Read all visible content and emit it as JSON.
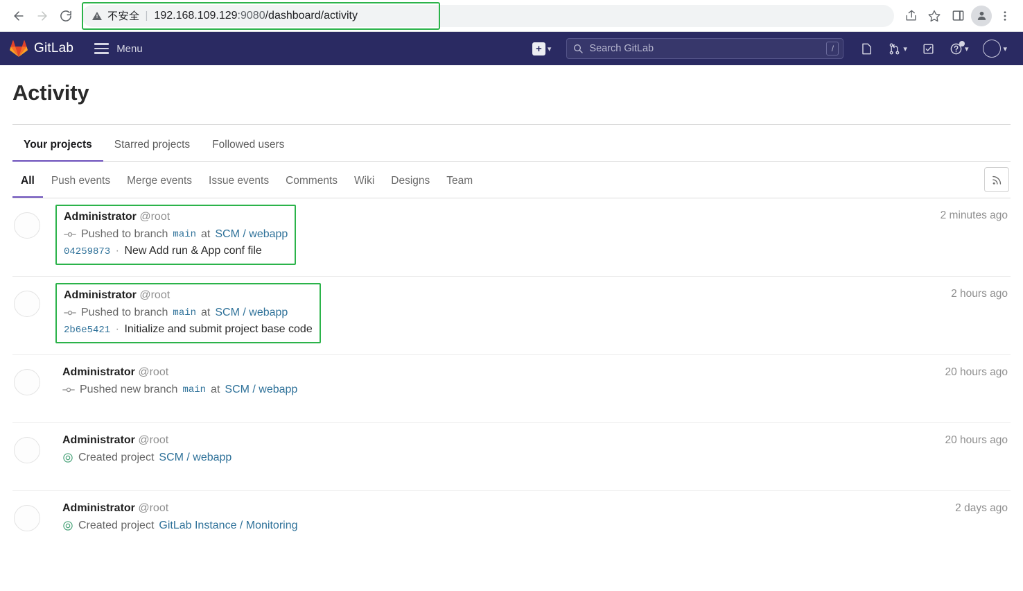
{
  "browser": {
    "back_icon": "back-arrow-icon",
    "forward_icon": "forward-arrow-icon",
    "reload_icon": "reload-icon",
    "security_label": "不安全",
    "url_host": "192.168.109.129",
    "url_port": ":9080",
    "url_path": "/dashboard/activity",
    "separator": "|",
    "share_icon": "share-icon",
    "bookmark_icon": "star-icon",
    "sidepanel_icon": "side-panel-icon",
    "profile_icon": "profile-avatar-icon",
    "menu_icon": "three-dot-menu-icon",
    "annotation_color": "#2bb34a"
  },
  "navbar": {
    "brand": "GitLab",
    "menu_label": "Menu",
    "background": "#2a2a62",
    "create_icon": "plus-square-icon",
    "search": {
      "placeholder": "Search GitLab",
      "shortcut": "/"
    },
    "icons": [
      {
        "name": "issues-icon",
        "label": "Issues"
      },
      {
        "name": "merge-requests-icon",
        "label": "Merge requests"
      },
      {
        "name": "todos-icon",
        "label": "To-Do List"
      },
      {
        "name": "help-icon",
        "label": "Help"
      },
      {
        "name": "user-avatar-icon",
        "label": "User menu"
      }
    ]
  },
  "page": {
    "title": "Activity",
    "top_tabs": [
      {
        "label": "Your projects",
        "active": true
      },
      {
        "label": "Starred projects",
        "active": false
      },
      {
        "label": "Followed users",
        "active": false
      }
    ],
    "filter_tabs": [
      {
        "label": "All",
        "active": true
      },
      {
        "label": "Push events",
        "active": false
      },
      {
        "label": "Merge events",
        "active": false
      },
      {
        "label": "Issue events",
        "active": false
      },
      {
        "label": "Comments",
        "active": false
      },
      {
        "label": "Wiki",
        "active": false
      },
      {
        "label": "Designs",
        "active": false
      },
      {
        "label": "Team",
        "active": false
      }
    ],
    "rss_icon": "rss-feed-icon",
    "accent_color": "#6b4fbb"
  },
  "feed": [
    {
      "user": "Administrator",
      "handle": "@root",
      "icon": "commit-icon",
      "action_prefix": "Pushed to branch",
      "branch": "main",
      "action_mid": "at",
      "project": "SCM / webapp",
      "commit_sha": "04259873",
      "commit_sep": "·",
      "commit_message": "New Add run & App conf file",
      "time": "2 minutes ago",
      "highlighted": true
    },
    {
      "user": "Administrator",
      "handle": "@root",
      "icon": "commit-icon",
      "action_prefix": "Pushed to branch",
      "branch": "main",
      "action_mid": "at",
      "project": "SCM / webapp",
      "commit_sha": "2b6e5421",
      "commit_sep": "·",
      "commit_message": "Initialize and submit project base code",
      "time": "2 hours ago",
      "highlighted": true
    },
    {
      "user": "Administrator",
      "handle": "@root",
      "icon": "commit-icon",
      "action_prefix": "Pushed new branch",
      "branch": "main",
      "action_mid": "at",
      "project": "SCM / webapp",
      "commit_sha": "",
      "commit_sep": "",
      "commit_message": "",
      "time": "20 hours ago",
      "highlighted": false
    },
    {
      "user": "Administrator",
      "handle": "@root",
      "icon": "project-created-icon",
      "action_prefix": "Created project",
      "branch": "",
      "action_mid": "",
      "project": "SCM / webapp",
      "commit_sha": "",
      "commit_sep": "",
      "commit_message": "",
      "time": "20 hours ago",
      "highlighted": false
    },
    {
      "user": "Administrator",
      "handle": "@root",
      "icon": "project-created-icon",
      "action_prefix": "Created project",
      "branch": "",
      "action_mid": "",
      "project": "GitLab Instance / Monitoring",
      "commit_sha": "",
      "commit_sep": "",
      "commit_message": "",
      "time": "2 days ago",
      "highlighted": false
    }
  ]
}
